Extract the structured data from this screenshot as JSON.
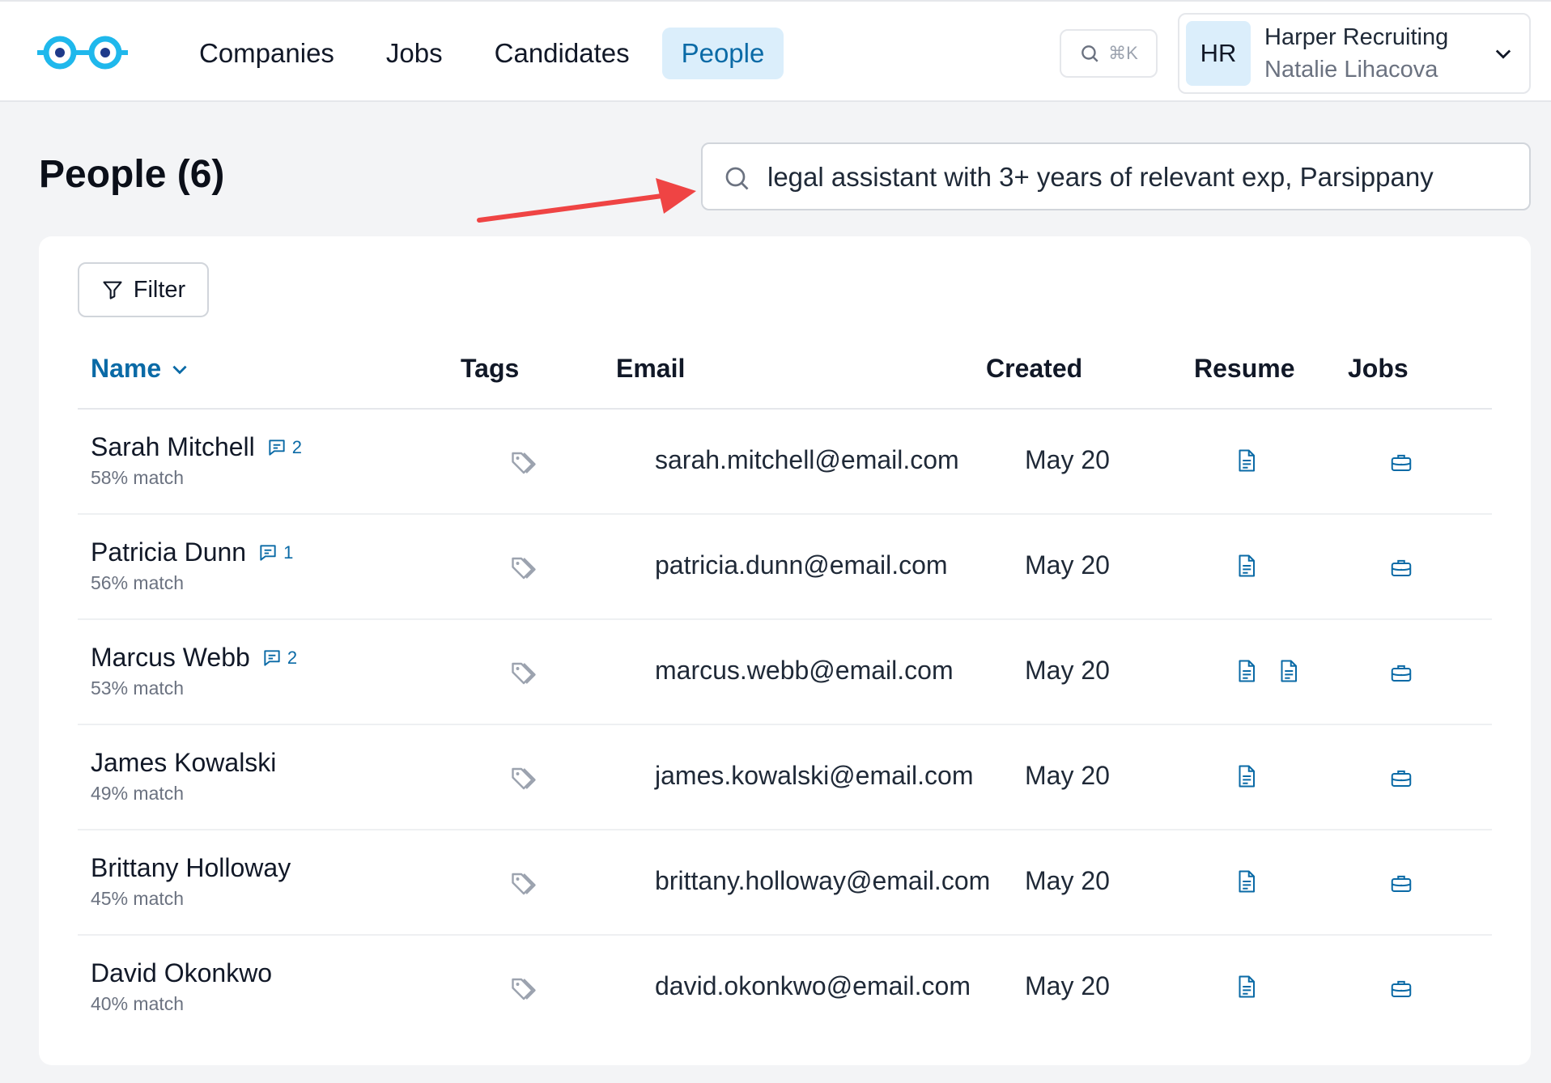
{
  "colors": {
    "accent": "#0a6aa6",
    "active_nav_bg": "#dbeefb",
    "logo": "#1fb8ec",
    "arrow": "#ef4444"
  },
  "nav": {
    "items": [
      {
        "label": "Companies",
        "active": false
      },
      {
        "label": "Jobs",
        "active": false
      },
      {
        "label": "Candidates",
        "active": false
      },
      {
        "label": "People",
        "active": true
      }
    ]
  },
  "command_palette": {
    "icon": "search-icon",
    "shortcut": "⌘K"
  },
  "account": {
    "initials": "HR",
    "org_name": "Harper Recruiting",
    "user_name": "Natalie Lihacova",
    "icon": "chevron-down-icon"
  },
  "page": {
    "title": "People (6)",
    "search_value": "legal assistant with 3+ years of relevant exp, Parsippany"
  },
  "filter": {
    "label": "Filter",
    "icon": "filter-icon"
  },
  "table": {
    "columns": {
      "name": "Name",
      "tags": "Tags",
      "email": "Email",
      "created": "Created",
      "resume": "Resume",
      "jobs": "Jobs"
    },
    "rows": [
      {
        "name": "Sarah Mitchell",
        "comments": "2",
        "match": "58% match",
        "email": "sarah.mitchell@email.com",
        "created": "May 20",
        "resumes": 1
      },
      {
        "name": "Patricia Dunn",
        "comments": "1",
        "match": "56% match",
        "email": "patricia.dunn@email.com",
        "created": "May 20",
        "resumes": 1
      },
      {
        "name": "Marcus Webb",
        "comments": "2",
        "match": "53% match",
        "email": "marcus.webb@email.com",
        "created": "May 20",
        "resumes": 2
      },
      {
        "name": "James Kowalski",
        "comments": null,
        "match": "49% match",
        "email": "james.kowalski@email.com",
        "created": "May 20",
        "resumes": 1
      },
      {
        "name": "Brittany Holloway",
        "comments": null,
        "match": "45% match",
        "email": "brittany.holloway@email.com",
        "created": "May 20",
        "resumes": 1
      },
      {
        "name": "David Okonkwo",
        "comments": null,
        "match": "40% match",
        "email": "david.okonkwo@email.com",
        "created": "May 20",
        "resumes": 1
      }
    ]
  }
}
